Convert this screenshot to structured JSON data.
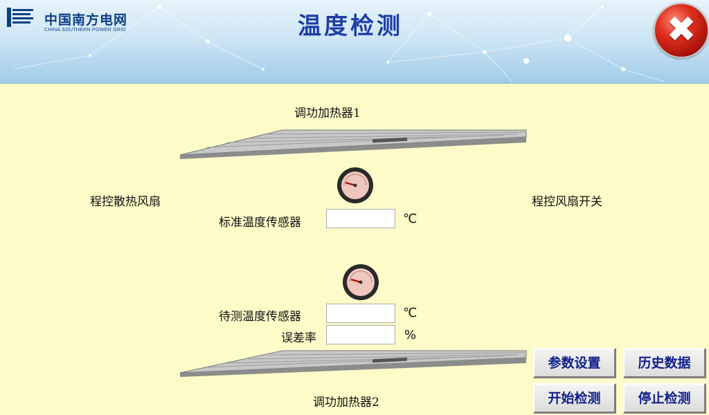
{
  "header": {
    "logo_cn": "中国南方电网",
    "logo_en": "CHINA SOUTHERN POWER GRID",
    "title": "温度检测",
    "close_icon": "close-icon"
  },
  "heaters": {
    "top_label": "调功加热器1",
    "bottom_label": "调功加热器2"
  },
  "fans": {
    "left_label": "程控散热风扇",
    "right_label": "程控风扇开关"
  },
  "sensors": {
    "standard": {
      "label": "标准温度传感器",
      "value": "",
      "unit": "℃"
    },
    "test": {
      "label": "待测温度传感器",
      "value": "",
      "unit": "℃"
    },
    "error_rate": {
      "label": "误差率",
      "value": "",
      "unit": "%"
    }
  },
  "buttons": {
    "params": "参数设置",
    "history": "历史数据",
    "start": "开始检测",
    "stop": "停止检测"
  },
  "colors": {
    "background": "#fdfcc9",
    "title": "#1f3fa6",
    "button_text": "#10208a",
    "close": "#d42a1a"
  }
}
